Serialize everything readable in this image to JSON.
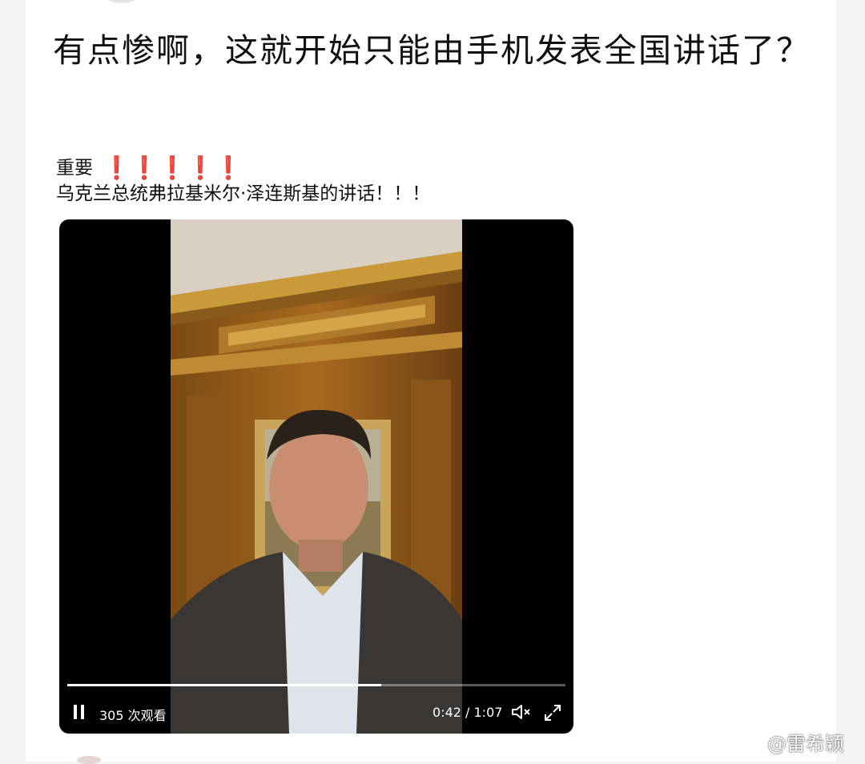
{
  "post": {
    "text": "有点惨啊，这就开始只能由手机发表全国讲话了？"
  },
  "quoted": {
    "label": "重要",
    "marks": "❗❗❗❗❗",
    "headline": "乌克兰总统弗拉基米尔·泽连斯基的讲话！！！"
  },
  "video": {
    "views": "305 次观看",
    "time": "0:42 / 1:07",
    "progress": 0.63
  },
  "watermark": {
    "handle": "@雷希颖"
  },
  "colors": {
    "accent_red": "#c8161d",
    "video_bg": "#000000"
  },
  "icons": [
    "pause-icon",
    "mute-icon",
    "fullscreen-icon",
    "weibo-logo-icon"
  ]
}
